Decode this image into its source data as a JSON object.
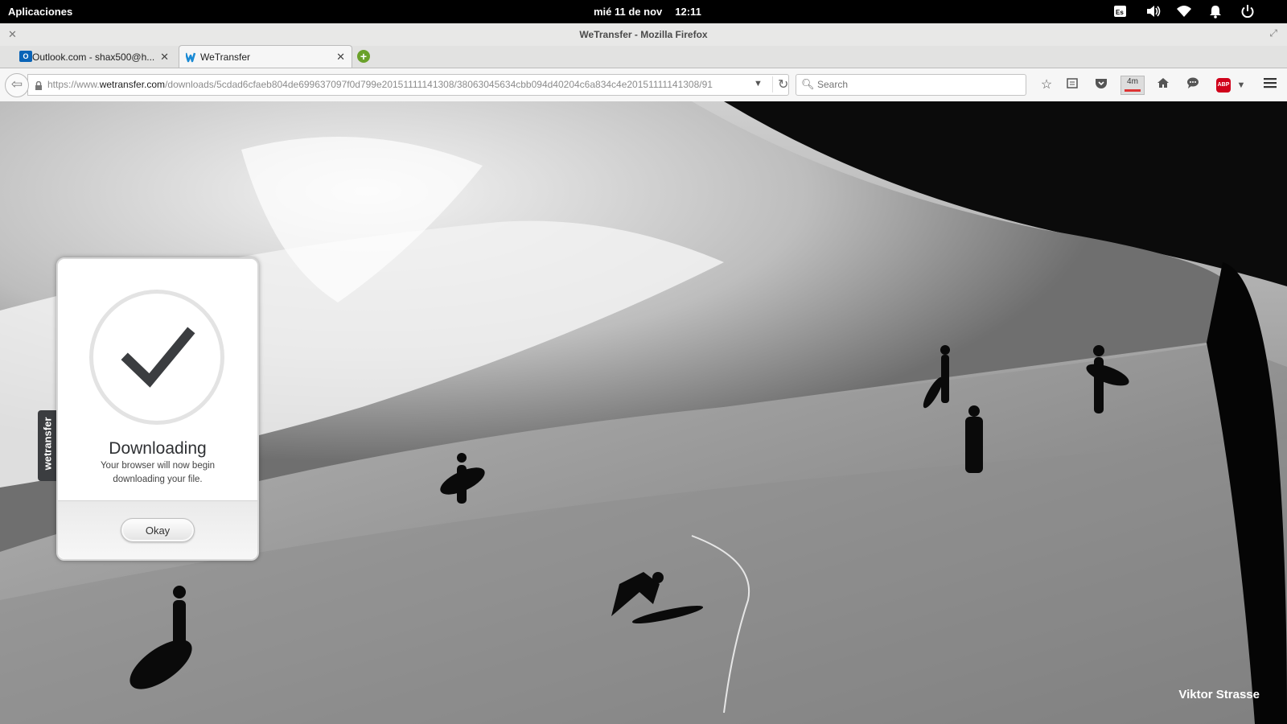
{
  "topbar": {
    "applications": "Aplicaciones",
    "date": "mié 11 de nov",
    "time": "12:11",
    "tray_icons": [
      "keyboard-layout-icon",
      "volume-icon",
      "wifi-icon",
      "notification-bell-icon",
      "power-icon"
    ],
    "keyboard_layout": "Es"
  },
  "window": {
    "title": "WeTransfer - Mozilla Firefox"
  },
  "tabs": [
    {
      "label": "Outlook.com - shax500@h...",
      "favicon": "outlook-icon",
      "active": false
    },
    {
      "label": "WeTransfer",
      "favicon": "wetransfer-icon",
      "active": true
    }
  ],
  "navbar": {
    "url_prefix": "https://www.",
    "url_domain": "wetransfer.com",
    "url_path": "/downloads/5cdad6cfaeb804de699637097f0d799e20151111141308/38063045634cbb094d40204c6a834c4e20151111141308/91",
    "search_placeholder": "Search",
    "timer_label": "4m",
    "abp_label": "ABP"
  },
  "page": {
    "side_tab": "wetransfer",
    "dialog": {
      "heading": "Downloading",
      "message": "Your browser will now begin downloading your file.",
      "button": "Okay"
    },
    "photo_credit": "Viktor Strasse"
  },
  "colors": {
    "accent_green": "#6aa12a",
    "abp_red": "#d0021b",
    "outlook_blue": "#0a64b7",
    "check_dark": "#3b3d40"
  }
}
